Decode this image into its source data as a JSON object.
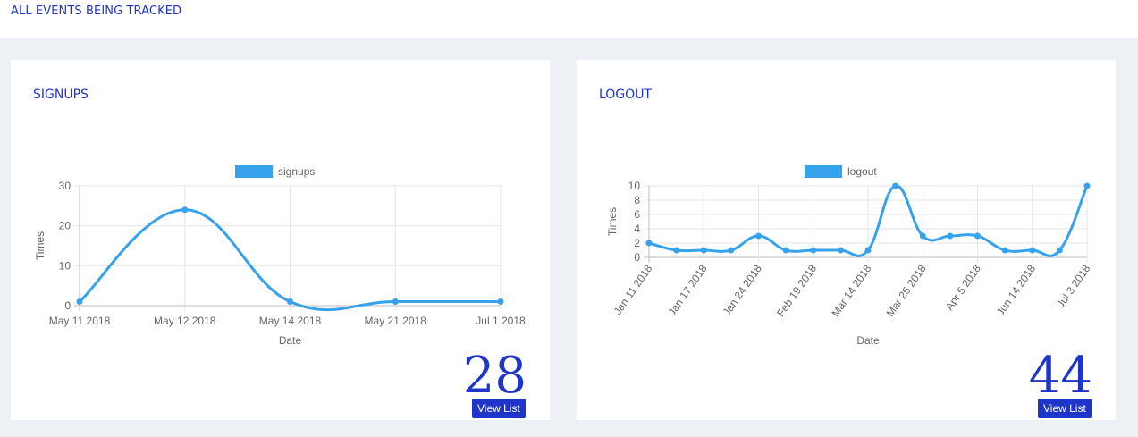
{
  "header": {
    "title": "ALL EVENTS BEING TRACKED"
  },
  "cards": [
    {
      "title": "SIGNUPS",
      "total": "28",
      "button_label": "View List"
    },
    {
      "title": "LOGOUT",
      "total": "44",
      "button_label": "View List"
    }
  ],
  "chart_data": [
    {
      "type": "line",
      "categories": [
        "May 11 2018",
        "May 12 2018",
        "May 14 2018",
        "May 21 2018",
        "Jul 1 2018"
      ],
      "series": [
        {
          "name": "signups",
          "values": [
            1,
            24,
            1,
            1,
            1
          ],
          "color": "#36a2eb"
        }
      ],
      "xlabel": "Date",
      "ylabel": "Times",
      "ylim": [
        0,
        30
      ],
      "yticks": [
        0,
        10,
        20,
        30
      ],
      "legend": "top-center",
      "grid": true
    },
    {
      "type": "line",
      "categories": [
        "Jan 11 2018",
        "Jan 17 2018",
        "Jan 24 2018",
        "Feb 19 2018",
        "Mar 14 2018",
        "Mar 25 2018",
        "Apr 5 2018",
        "Jun 14 2018",
        "Jul 3 2018"
      ],
      "series": [
        {
          "name": "logout",
          "values": [
            2,
            1,
            1,
            1,
            3,
            1,
            1,
            1,
            1,
            10,
            3,
            3,
            3,
            1,
            1,
            1,
            10
          ],
          "color": "#36a2eb"
        }
      ],
      "xlabel": "Date",
      "ylabel": "Times",
      "ylim": [
        0,
        10
      ],
      "yticks": [
        0,
        2,
        4,
        6,
        8,
        10
      ],
      "legend": "top-center",
      "grid": true
    }
  ]
}
